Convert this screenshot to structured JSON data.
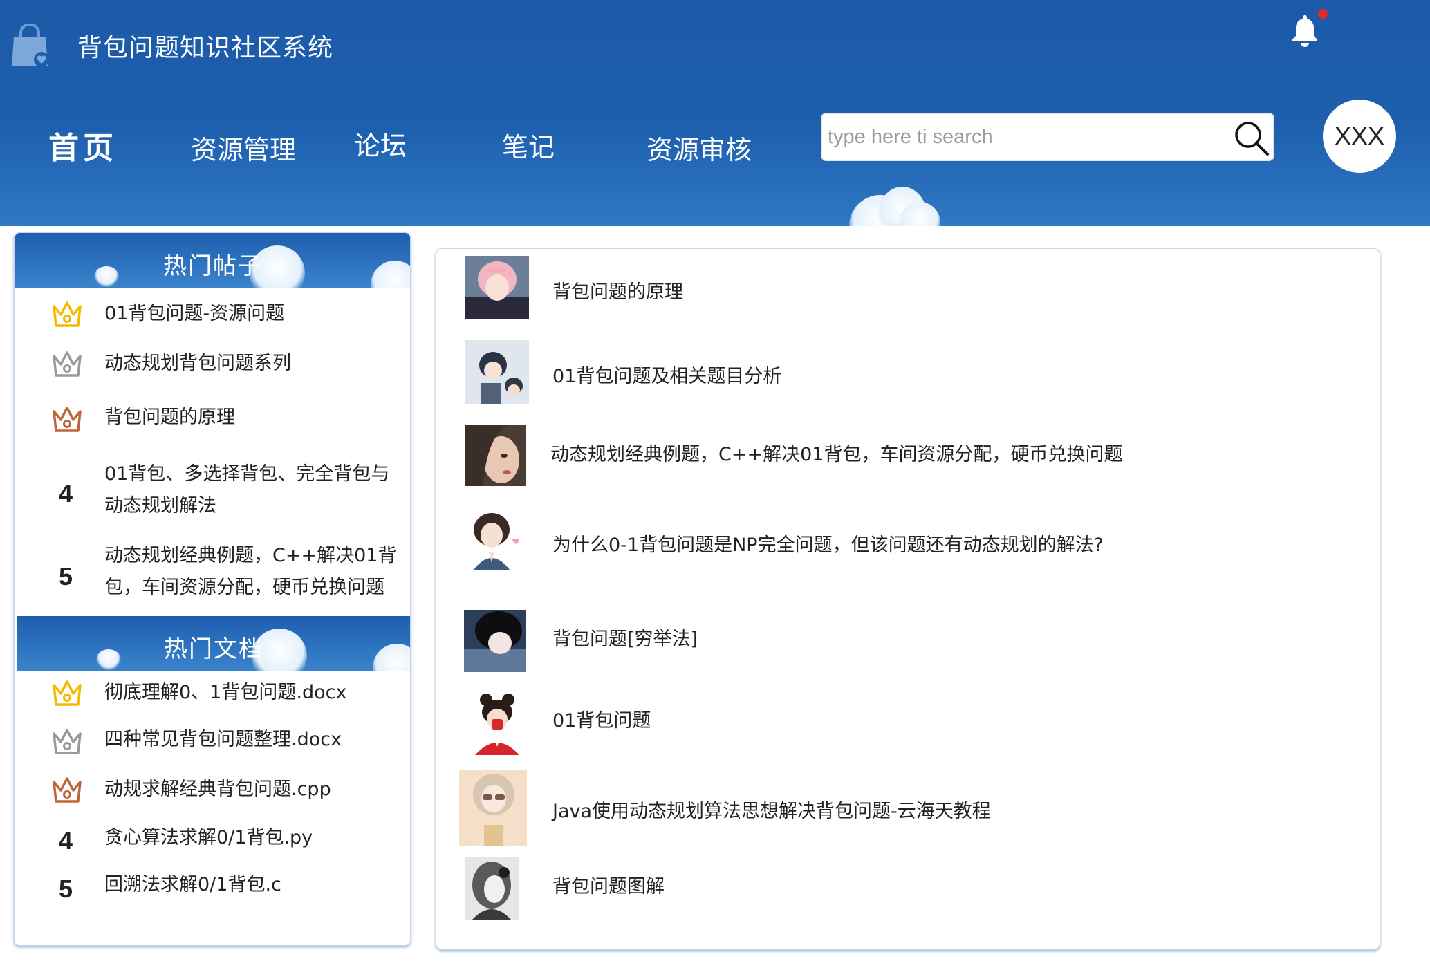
{
  "header": {
    "app_title": "背包问题知识社区系统",
    "nav": {
      "home": "首页",
      "resource_management": "资源管理",
      "forum": "论坛",
      "notes": "笔记",
      "resource_review": "资源审核"
    },
    "search": {
      "placeholder": "type here ti search",
      "value": ""
    },
    "user_name": "XXX",
    "notification_unread": true
  },
  "hot_posts": {
    "title": "热门帖子",
    "items": [
      {
        "rank": "1",
        "icon": "gold-crown-icon",
        "text": "01背包问题-资源问题"
      },
      {
        "rank": "2",
        "icon": "silver-crown-icon",
        "text": "动态规划背包问题系列"
      },
      {
        "rank": "3",
        "icon": "bronze-crown-icon",
        "text": "背包问题的原理"
      },
      {
        "rank": "4",
        "text": "01背包、多选择背包、完全背包与动态规划解法"
      },
      {
        "rank": "5",
        "text": "动态规划经典例题，C++解决01背包，车间资源分配，硬币兑换问题"
      }
    ]
  },
  "hot_docs": {
    "title": "热门文档",
    "items": [
      {
        "rank": "1",
        "icon": "gold-crown-icon",
        "text": "彻底理解0、1背包问题.docx"
      },
      {
        "rank": "2",
        "icon": "silver-crown-icon",
        "text": "四种常见背包问题整理.docx"
      },
      {
        "rank": "3",
        "icon": "bronze-crown-icon",
        "text": "动规求解经典背包问题.cpp"
      },
      {
        "rank": "4",
        "text": "贪心算法求解0/1背包.py"
      },
      {
        "rank": "5",
        "text": "回溯法求解0/1背包.c"
      }
    ]
  },
  "posts": [
    {
      "title": "背包问题的原理",
      "avatar": "pink-hair-boy-avatar"
    },
    {
      "title": "01背包问题及相关题目分析",
      "avatar": "couple-avatar"
    },
    {
      "title": "动态规划经典例题，C++解决01背包，车间资源分配，硬币兑换问题",
      "avatar": "girl-portrait-avatar"
    },
    {
      "title": "为什么0-1背包问题是NP完全问题，但该问题还有动态规划的解法?",
      "avatar": "girl-illustration-avatar"
    },
    {
      "title": "背包问题[穷举法]",
      "avatar": "dark-hair-boy-avatar"
    },
    {
      "title": "01背包问题",
      "avatar": "red-outfit-girl-avatar"
    },
    {
      "title": "Java使用动态规划算法思想解决背包问题-云海天教程",
      "avatar": "sunglasses-girl-avatar"
    },
    {
      "title": "背包问题图解",
      "avatar": "monochrome-girl-avatar"
    }
  ],
  "colors": {
    "header_blue": "#1d5fae",
    "gold": "#f5b800",
    "silver": "#9a9a9a",
    "bronze": "#c0643a",
    "panel_border": "#c5d4ea"
  }
}
